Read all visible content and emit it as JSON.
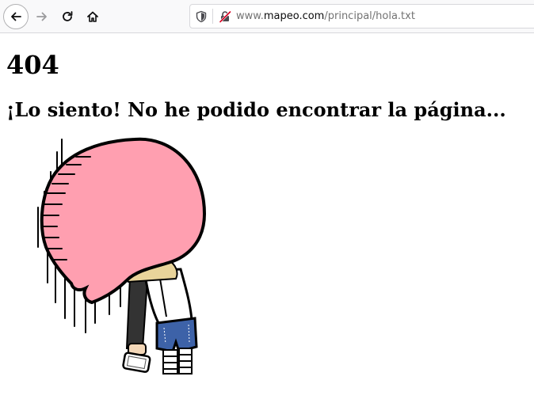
{
  "browser": {
    "url": {
      "prefix": "www.",
      "host": "mapeo.com",
      "path": "/principal/hola.txt"
    }
  },
  "page": {
    "heading": "404",
    "message": "¡Lo siento! No he podido encontrar la página..."
  },
  "icons": {
    "back": "arrow-left-icon",
    "forward": "arrow-right-icon",
    "reload": "reload-icon",
    "home": "home-icon",
    "tracking": "shield-icon",
    "security": "insecure-lock-icon"
  },
  "colors": {
    "head": "#ff9fb0",
    "shorts": "#3d62a8",
    "hair": "#e9d49a"
  }
}
